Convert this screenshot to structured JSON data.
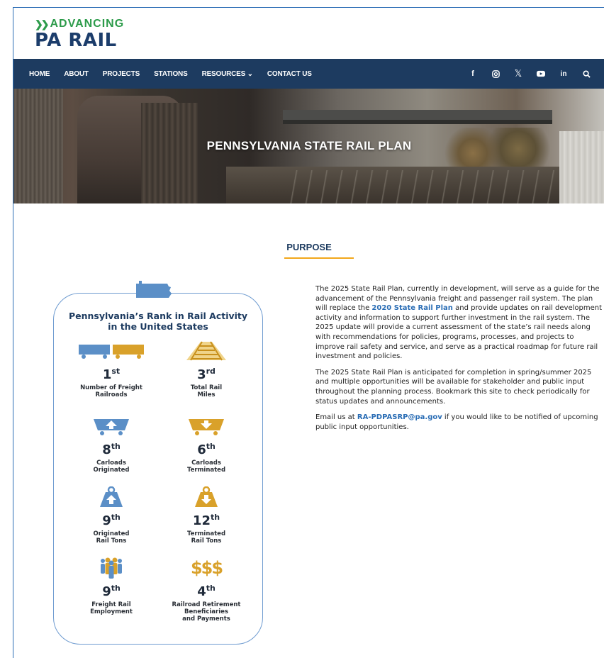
{
  "logo": {
    "top_text": "ADVANCING",
    "bottom_text": "PA RAIL"
  },
  "nav": {
    "items": [
      "HOME",
      "ABOUT",
      "PROJECTS",
      "STATIONS",
      "RESOURCES ⌄",
      "CONTACT US"
    ],
    "icons": [
      "facebook-icon",
      "instagram-icon",
      "x-icon",
      "youtube-icon",
      "linkedin-icon",
      "search-icon"
    ]
  },
  "hero": {
    "title": "PENNSYLVANIA STATE RAIL PLAN"
  },
  "purpose": {
    "heading": "PURPOSE"
  },
  "infographic": {
    "title_line1": "Pennsylvania’s Rank in Rail Activity",
    "title_line2": "in the United States",
    "colors": {
      "blue": "#5b8fc7",
      "gold": "#d9a12a"
    },
    "stats": [
      {
        "rank": "1",
        "suffix": "st",
        "label_lines": [
          "Number of Freight",
          "Railroads"
        ],
        "icon": "freight-cars-icon"
      },
      {
        "rank": "3",
        "suffix": "rd",
        "label_lines": [
          "Total Rail",
          "Miles"
        ],
        "icon": "rail-track-icon"
      },
      {
        "rank": "8",
        "suffix": "th",
        "label_lines": [
          "Carloads",
          "Originated"
        ],
        "icon": "carload-up-icon"
      },
      {
        "rank": "6",
        "suffix": "th",
        "label_lines": [
          "Carloads",
          "Terminated"
        ],
        "icon": "carload-down-icon"
      },
      {
        "rank": "9",
        "suffix": "th",
        "label_lines": [
          "Originated",
          "Rail Tons"
        ],
        "icon": "weight-up-icon"
      },
      {
        "rank": "12",
        "suffix": "th",
        "label_lines": [
          "Terminated",
          "Rail Tons"
        ],
        "icon": "weight-down-icon"
      },
      {
        "rank": "9",
        "suffix": "th",
        "label_lines": [
          "Freight Rail",
          "Employment"
        ],
        "icon": "people-icon"
      },
      {
        "rank": "4",
        "suffix": "th",
        "label_lines": [
          "Railroad Retirement",
          "Beneficiaries",
          "and Payments"
        ],
        "icon": "dollar-signs-icon",
        "icon_text": "$$$"
      }
    ]
  },
  "content": {
    "p1_before": "The 2025 State Rail Plan, currently in development, will serve as a guide for the advancement of the Pennsylvania freight and passenger rail system. The plan will replace the ",
    "p1_link": "2020 State Rail Plan",
    "p1_after": " and provide updates on rail development activity and information to support further investment in the rail system. The 2025 update will provide a current assessment of the state’s rail needs along with recommendations for policies, programs, processes, and projects to improve rail safety and service, and serve as a practical roadmap for future rail investment and policies.",
    "p2": "The 2025 State Rail Plan is anticipated for completion in spring/summer 2025 and multiple opportunities will be available for stakeholder and public input throughout the planning process. Bookmark this site to check periodically for status updates and announcements.",
    "p3_before": "Email us at ",
    "p3_link": "RA-PDPASRP@pa.gov",
    "p3_after": " if you would like to be notified of upcoming public input opportunities."
  }
}
